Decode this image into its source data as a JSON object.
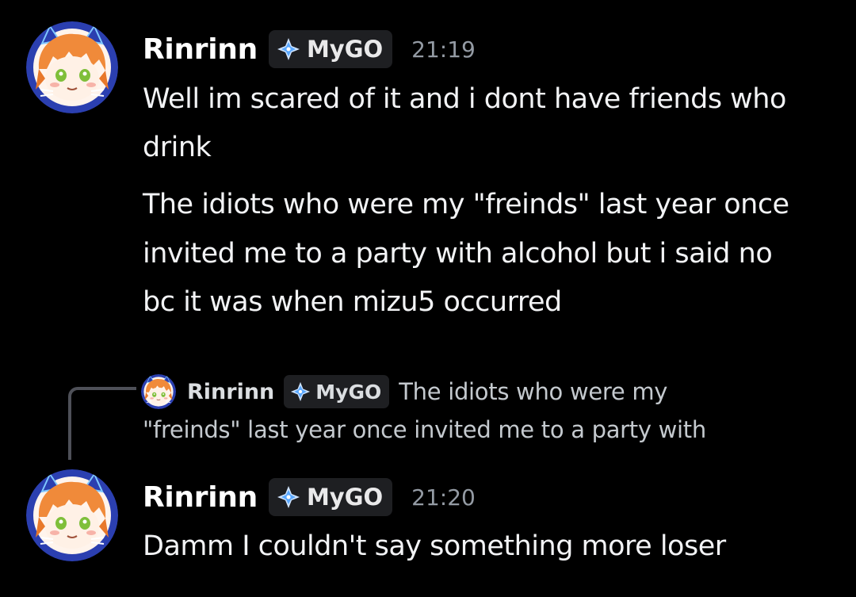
{
  "messages": [
    {
      "username": "Rinrinn",
      "tag": "MyGO",
      "timestamp": "21:19",
      "lines": [
        "Well im scared of it and i dont have friends who",
        "drink",
        "The idiots who were my \"freinds\" last year once",
        "invited me to a party with alcohol but i said no",
        "bc it was when mizu5 occurred"
      ]
    },
    {
      "reply": {
        "username": "Rinrinn",
        "tag": "MyGO",
        "line1": "The idiots who were my",
        "line2": "\"freinds\" last year once invited me to a party with"
      },
      "username": "Rinrinn",
      "tag": "MyGO",
      "timestamp": "21:20",
      "lines": [
        "Damm I couldn't say something more loser"
      ]
    }
  ],
  "colors": {
    "background": "#000000",
    "username": "#ffffff",
    "message_text": "#f2f3f5",
    "timestamp": "#949ba4",
    "tag_bg": "#1e1f22",
    "reply_spine": "#4e5058",
    "avatar_ring": "#2b3fb0"
  },
  "icons": {
    "avatar": "cat-girl-avatar-icon",
    "tag": "sparkle-diamond-icon"
  }
}
